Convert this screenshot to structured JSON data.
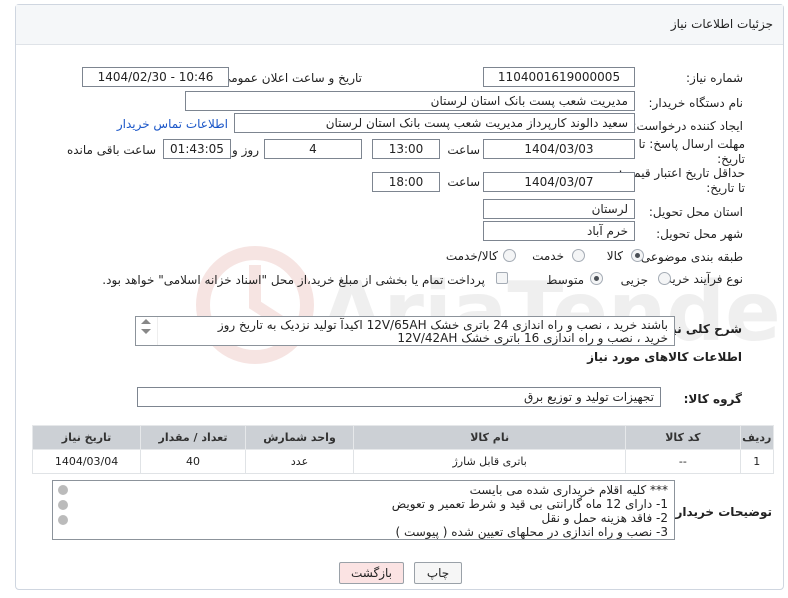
{
  "header": {
    "title": "جزئیات اطلاعات نیاز"
  },
  "fields": {
    "need_number_label": "شماره نیاز:",
    "need_number": "1104001619000005",
    "announce_label": "تاریخ و ساعت اعلان عمومی:",
    "announce_value": "1404/02/30 - 10:46",
    "buyer_org_label": "نام دستگاه خریدار:",
    "buyer_org": "مدیریت شعب پست بانک استان لرستان",
    "creator_label": "ایجاد کننده درخواست:",
    "creator": "سعید دالوند کارپرداز مدیریت شعب پست بانک استان لرستان",
    "contact_link": "اطلاعات تماس خریدار",
    "deadline_label_1": "مهلت ارسال پاسخ: تا",
    "deadline_label_2": "تاریخ:",
    "deadline_date": "1404/03/03",
    "time_label": "ساعت",
    "deadline_time": "13:00",
    "days_value": "4",
    "days_label": "روز و",
    "remaining_time": "01:43:05",
    "remaining_label": "ساعت باقی مانده",
    "price_validity_label_1": "حداقل تاریخ اعتبار قیمت:",
    "price_validity_label_2": "تا تاریخ:",
    "price_validity_date": "1404/03/07",
    "price_validity_time": "18:00",
    "province_label": "استان محل تحویل:",
    "province": "لرستان",
    "city_label": "شهر محل تحویل:",
    "city": "خرم آباد",
    "category_label": "طبقه بندی موضوعی:",
    "category_options": [
      "کالا",
      "خدمت",
      "کالا/خدمت"
    ],
    "process_label": "نوع فرآیند خرید :",
    "process_options": [
      "جزیی",
      "متوسط"
    ],
    "payment_note": "پرداخت تمام یا بخشی از مبلغ خرید،از محل \"اسناد خزانه اسلامی\" خواهد بود."
  },
  "description": {
    "label": "شرح کلی نیاز:",
    "line1": "باشند خرید ، نصب و راه اندازی 24 باتری خشک 12V/65AH اکیدآ تولید نزدیک به تاریخ روز",
    "line2": "خرید ، نصب و راه اندازی 16 باتری خشک 12V/42AH"
  },
  "goods_section": {
    "title": "اطلاعات کالاهای مورد نیاز",
    "group_label": "گروه کالا:",
    "group_value": "تجهیزات تولید و توزیع برق"
  },
  "table": {
    "headers": [
      "ردیف",
      "کد کالا",
      "نام کالا",
      "واحد شمارش",
      "تعداد / مقدار",
      "تاریخ نیاز"
    ],
    "rows": [
      [
        "1",
        "--",
        "باتری قابل شارژ",
        "عدد",
        "40",
        "1404/03/04"
      ]
    ]
  },
  "buyer_notes": {
    "label": "توضیحات خریدار:",
    "lines": [
      "*** کلیه اقلام خریداری شده می بایست",
      "1- دارای 12 ماه گارانتی بی قید و شرط تعمیر و تعویض",
      "2- فاقد هزینه حمل و نقل",
      "3- نصب و راه اندازی در محلهای تعیین شده ( پیوست )"
    ]
  },
  "buttons": {
    "print": "چاپ",
    "back": "بازگشت"
  },
  "watermark": {
    "text": "AriaTender.neT"
  },
  "colors": {
    "link": "#1a56c8",
    "back_button": "#fbe3e3",
    "table_header": "#ccd0d5"
  }
}
